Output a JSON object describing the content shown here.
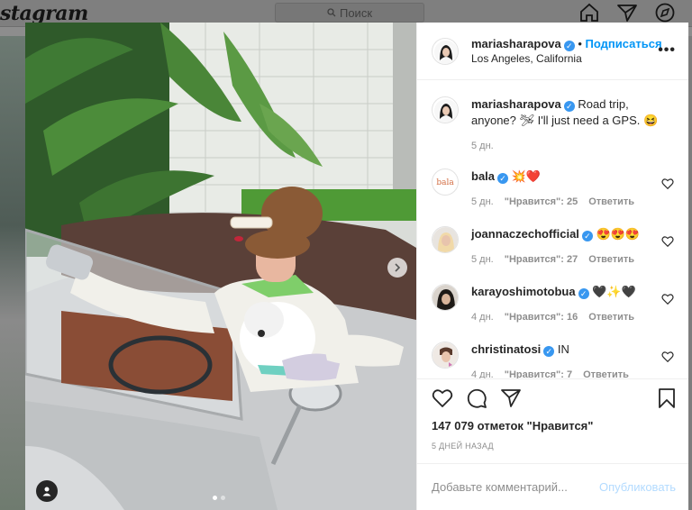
{
  "app": {
    "logo_text": "stagram",
    "search_placeholder": "Поиск",
    "nav_icons": [
      "home-icon",
      "direct-icon",
      "explore-icon"
    ]
  },
  "post": {
    "author": "mariasharapova",
    "follow_label": "Подписаться",
    "separator": "•",
    "location": "Los Angeles, California",
    "more_label": "•••",
    "caption_author": "mariasharapova",
    "caption_text": "Road trip, anyone? 🛩 I'll just need a GPS. 😆",
    "caption_time": "5 дн.",
    "carousel_index": 1,
    "carousel_count": 2
  },
  "comments": [
    {
      "user": "bala",
      "text": "💥❤️",
      "time": "5 дн.",
      "likes": "\"Нравится\": 25",
      "reply": "Ответить",
      "avatar": "bala-logo"
    },
    {
      "user": "joannaczechofficial",
      "text": "😍😍😍",
      "time": "5 дн.",
      "likes": "\"Нравится\": 27",
      "reply": "Ответить",
      "avatar": "joanna"
    },
    {
      "user": "karayoshimotobua",
      "text": "🖤✨🖤",
      "time": "4 дн.",
      "likes": "\"Нравится\": 16",
      "reply": "Ответить",
      "avatar": "kara"
    },
    {
      "user": "christinatosi",
      "text": "IN",
      "time": "4 дн.",
      "likes": "\"Нравится\": 7",
      "reply": "Ответить",
      "avatar": "christina"
    }
  ],
  "actions": {
    "likes_count": "147 079",
    "likes_suffix": "отметок \"Нравится\"",
    "date_label": "5 дней назад"
  },
  "comment_box": {
    "placeholder": "Добавьте комментарий...",
    "publish_label": "Опубликовать"
  },
  "colors": {
    "accent": "#0095f6",
    "verified": "#3897f0",
    "publish_disabled": "#b3dbff"
  }
}
